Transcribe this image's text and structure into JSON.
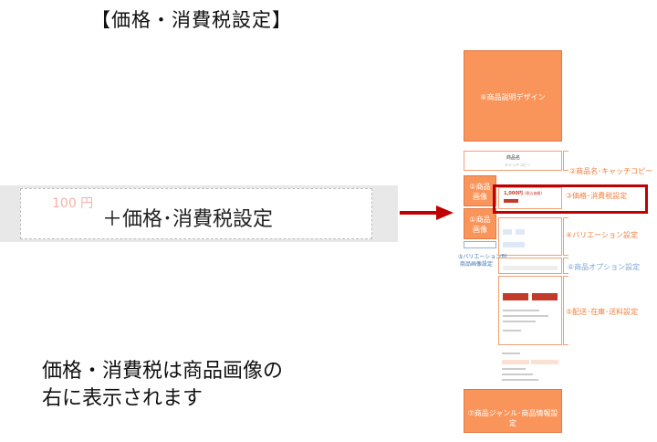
{
  "title": "【価格・消費税設定】",
  "price_field": {
    "ghost_value": "100 円",
    "label": "＋価格･消費税設定"
  },
  "note": [
    "価格・消費税は商品画像の",
    "右に表示されます"
  ],
  "mock": {
    "design_block": "⑥商品説明デザイン",
    "product_name": "商品名",
    "catch_copy": "キャッチコピー",
    "image1": [
      "①商品",
      "画像"
    ],
    "image2": [
      "①商品",
      "画像"
    ],
    "price_text": "1,000円",
    "price_tax": "(税込価格)",
    "labels": {
      "name": "②商品名･キャッチコピー",
      "price": "③価格･消費税設定",
      "variation": "④バリエーション設定",
      "option": "⑥商品オプション設定",
      "shipping": "⑤配送･在庫･送料設定",
      "variation_image": [
        "⑤バリエーション別",
        "商品画像設定"
      ]
    },
    "genre_block": "⑦商品ジャンル･商品情報設定"
  },
  "colors": {
    "accent": "#f9955b",
    "highlight": "#c00000",
    "arrow": "#c00000"
  }
}
